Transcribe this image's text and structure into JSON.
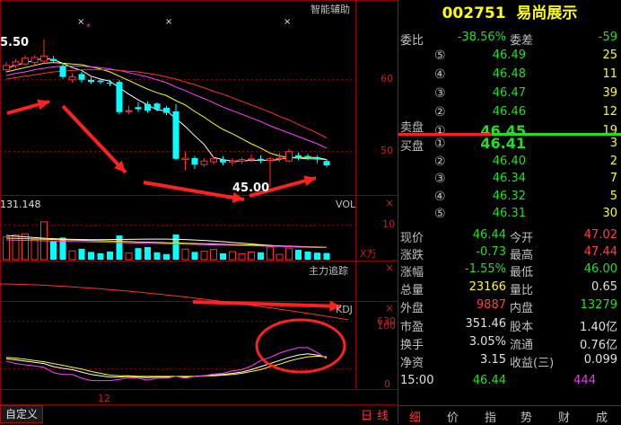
{
  "chart": {
    "title": "智能辅助",
    "price_high_label": "5.50",
    "price_low_label": "45.00",
    "price_axis": [
      "60",
      "50"
    ],
    "vol_panel": {
      "title": "VOL",
      "value": "131.148",
      "axis": "10",
      "unit": "X万"
    },
    "zlzj_panel": {
      "title": "主力追踪",
      "axis": "630"
    },
    "kdj_panel": {
      "title": "KDJ",
      "axis": [
        "100",
        "0"
      ]
    },
    "date_label": "12",
    "close_symbol": "×",
    "bottom_left": "自定义",
    "bottom_right": [
      "日",
      "线"
    ],
    "colors": {
      "up": "#ff3030",
      "down": "#00ffff",
      "ma5": "#ffffff",
      "ma10": "#ffff00",
      "ma20": "#ff40ff",
      "ma30": "#ff3030",
      "grid": "#8b0000"
    }
  },
  "quote": {
    "code": "002751",
    "name": "易尚展示",
    "weibi_label": "委比",
    "weibi_value": "-38.56%",
    "weicha_label": "委差",
    "weicha_value": "-59",
    "sell_label": "卖盘",
    "buy_label": "买盘",
    "sells": [
      {
        "n": "⑤",
        "price": "46.49",
        "vol": "25"
      },
      {
        "n": "④",
        "price": "46.48",
        "vol": "11"
      },
      {
        "n": "③",
        "price": "46.47",
        "vol": "39"
      },
      {
        "n": "②",
        "price": "46.46",
        "vol": "12"
      },
      {
        "n": "①",
        "price": "46.45",
        "vol": "19"
      }
    ],
    "buys": [
      {
        "n": "①",
        "price": "46.41",
        "vol": "3"
      },
      {
        "n": "②",
        "price": "46.40",
        "vol": "2"
      },
      {
        "n": "③",
        "price": "46.34",
        "vol": "7"
      },
      {
        "n": "④",
        "price": "46.32",
        "vol": "5"
      },
      {
        "n": "⑤",
        "price": "46.31",
        "vol": "30"
      }
    ],
    "stats": [
      {
        "l1": "现价",
        "v1": "46.44",
        "c1": "green",
        "l2": "今开",
        "v2": "47.02",
        "c2": "red"
      },
      {
        "l1": "涨跌",
        "v1": "-0.73",
        "c1": "green",
        "l2": "最高",
        "v2": "47.44",
        "c2": "red"
      },
      {
        "l1": "涨幅",
        "v1": "-1.55%",
        "c1": "green",
        "l2": "最低",
        "v2": "46.00",
        "c2": "green"
      },
      {
        "l1": "总量",
        "v1": "23166",
        "c1": "yellow",
        "l2": "量比",
        "v2": "0.65",
        "c2": "white"
      },
      {
        "l1": "外盘",
        "v1": "9887",
        "c1": "red",
        "l2": "内盘",
        "v2": "13279",
        "c2": "green"
      },
      {
        "l1": "市盈",
        "v1": "351.46",
        "c1": "white",
        "l2": "股本",
        "v2": "1.40亿",
        "c2": "white"
      },
      {
        "l1": "换手",
        "v1": "3.05%",
        "c1": "white",
        "l2": "流通",
        "v2": "0.76亿",
        "c2": "white"
      },
      {
        "l1": "净资",
        "v1": "3.15",
        "c1": "white",
        "l2": "收益(三)",
        "v2": "0.099",
        "c2": "white"
      }
    ],
    "tick": {
      "time": "15:00",
      "price": "46.44",
      "vol": "444"
    },
    "tabs": [
      "细",
      "价",
      "指",
      "势",
      "财",
      "成"
    ]
  },
  "chart_data": {
    "type": "candlestick",
    "title": "",
    "y_range": [
      43,
      68
    ],
    "high_marker": 65.5,
    "low_marker": 45.0,
    "candles": [
      {
        "o": 61.3,
        "c": 61.9,
        "h": 62.4,
        "l": 60.9,
        "dir": "up"
      },
      {
        "o": 61.9,
        "c": 62.4,
        "h": 62.8,
        "l": 61.5,
        "dir": "up"
      },
      {
        "o": 62.1,
        "c": 62.9,
        "h": 63.3,
        "l": 61.8,
        "dir": "up"
      },
      {
        "o": 62.3,
        "c": 63.0,
        "h": 63.3,
        "l": 61.9,
        "dir": "up"
      },
      {
        "o": 62.5,
        "c": 63.2,
        "h": 65.5,
        "l": 62.1,
        "dir": "up"
      },
      {
        "o": 62.8,
        "c": 62.5,
        "h": 63.2,
        "l": 62.2,
        "dir": "down"
      },
      {
        "o": 61.8,
        "c": 60.3,
        "h": 62.2,
        "l": 60.0,
        "dir": "down"
      },
      {
        "o": 60.3,
        "c": 59.9,
        "h": 60.8,
        "l": 59.5,
        "dir": "up"
      },
      {
        "o": 60.7,
        "c": 59.9,
        "h": 61.0,
        "l": 59.5,
        "dir": "down"
      },
      {
        "o": 59.9,
        "c": 59.6,
        "h": 60.3,
        "l": 59.3,
        "dir": "down"
      },
      {
        "o": 59.8,
        "c": 59.6,
        "h": 60.1,
        "l": 59.3,
        "dir": "down"
      },
      {
        "o": 59.5,
        "c": 59.4,
        "h": 59.9,
        "l": 59.0,
        "dir": "down"
      },
      {
        "o": 59.6,
        "c": 55.4,
        "h": 59.9,
        "l": 55.1,
        "dir": "down"
      },
      {
        "o": 55.5,
        "c": 55.6,
        "h": 56.3,
        "l": 55.1,
        "dir": "up"
      },
      {
        "o": 56.1,
        "c": 55.8,
        "h": 56.8,
        "l": 55.4,
        "dir": "down"
      },
      {
        "o": 56.5,
        "c": 55.6,
        "h": 56.9,
        "l": 55.3,
        "dir": "down"
      },
      {
        "o": 56.6,
        "c": 55.8,
        "h": 56.8,
        "l": 55.5,
        "dir": "down"
      },
      {
        "o": 56.0,
        "c": 55.3,
        "h": 56.3,
        "l": 55.0,
        "dir": "down"
      },
      {
        "o": 55.5,
        "c": 48.9,
        "h": 56.5,
        "l": 48.7,
        "dir": "down"
      },
      {
        "o": 48.8,
        "c": 49.0,
        "h": 49.9,
        "l": 47.3,
        "dir": "up"
      },
      {
        "o": 49.0,
        "c": 48.1,
        "h": 49.3,
        "l": 47.5,
        "dir": "down"
      },
      {
        "o": 48.1,
        "c": 48.6,
        "h": 49.0,
        "l": 47.8,
        "dir": "up"
      },
      {
        "o": 48.5,
        "c": 48.9,
        "h": 49.2,
        "l": 48.1,
        "dir": "up"
      },
      {
        "o": 48.8,
        "c": 48.4,
        "h": 49.3,
        "l": 48.0,
        "dir": "down"
      },
      {
        "o": 48.4,
        "c": 48.6,
        "h": 49.0,
        "l": 47.9,
        "dir": "up"
      },
      {
        "o": 48.6,
        "c": 48.8,
        "h": 49.1,
        "l": 48.2,
        "dir": "up"
      },
      {
        "o": 48.8,
        "c": 48.9,
        "h": 49.5,
        "l": 48.4,
        "dir": "up"
      },
      {
        "o": 48.9,
        "c": 48.7,
        "h": 49.4,
        "l": 48.3,
        "dir": "down"
      },
      {
        "o": 48.7,
        "c": 48.9,
        "h": 49.2,
        "l": 45.0,
        "dir": "up"
      },
      {
        "o": 48.9,
        "c": 49.0,
        "h": 49.7,
        "l": 48.5,
        "dir": "up"
      },
      {
        "o": 48.6,
        "c": 49.9,
        "h": 50.3,
        "l": 48.4,
        "dir": "up"
      },
      {
        "o": 49.4,
        "c": 49.0,
        "h": 49.8,
        "l": 48.7,
        "dir": "down"
      },
      {
        "o": 49.3,
        "c": 49.0,
        "h": 49.6,
        "l": 48.7,
        "dir": "down"
      },
      {
        "o": 49.0,
        "c": 48.8,
        "h": 49.4,
        "l": 48.3,
        "dir": "down"
      },
      {
        "o": 48.6,
        "c": 48.0,
        "h": 48.9,
        "l": 47.7,
        "dir": "down"
      }
    ],
    "ma_series": [
      {
        "name": "MA5",
        "color": "#ffffff",
        "values": [
          61.5,
          61.9,
          62.3,
          62.6,
          62.9,
          62.7,
          62.2,
          61.6,
          61.2,
          60.4,
          60.0,
          59.7,
          58.8,
          57.9,
          57.1,
          56.4,
          55.7,
          55.6,
          54.5,
          53.4,
          52.1,
          50.9,
          49.1,
          48.8,
          48.6,
          48.6,
          48.7,
          48.7,
          48.7,
          48.8,
          49.1,
          49.1,
          49.1,
          49.1,
          48.8
        ]
      },
      {
        "name": "MA10",
        "color": "#ffff00",
        "values": [
          61.0,
          61.3,
          61.6,
          61.9,
          62.2,
          62.3,
          62.2,
          62.1,
          62.0,
          61.7,
          61.4,
          61.0,
          60.4,
          59.8,
          59.2,
          58.6,
          58.1,
          57.7,
          57.0,
          56.4,
          55.5,
          54.7,
          53.8,
          53.0,
          52.4,
          51.7,
          51.0,
          50.4,
          49.7,
          49.3,
          49.1,
          49.0,
          48.9,
          48.9,
          48.8
        ]
      },
      {
        "name": "MA20",
        "color": "#ff40ff",
        "values": [
          60.5,
          60.8,
          61.0,
          61.3,
          61.5,
          61.7,
          61.8,
          61.8,
          61.8,
          61.7,
          61.6,
          61.4,
          61.2,
          60.9,
          60.6,
          60.3,
          59.9,
          59.5,
          58.9,
          58.4,
          57.8,
          57.3,
          56.7,
          56.1,
          55.6,
          55.1,
          54.6,
          54.1,
          53.5,
          53.0,
          52.5,
          52.0,
          51.5,
          51.0,
          50.4
        ]
      },
      {
        "name": "MA30",
        "color": "#ff3030",
        "values": [
          60.0,
          60.2,
          60.4,
          60.6,
          60.8,
          61.0,
          61.1,
          61.2,
          61.3,
          61.3,
          61.3,
          61.3,
          61.2,
          61.1,
          61.0,
          60.8,
          60.6,
          60.3,
          60.0,
          59.6,
          59.2,
          58.8,
          58.3,
          57.9,
          57.4,
          56.9,
          56.4,
          55.9,
          55.4,
          54.8,
          54.3,
          53.7,
          53.1,
          52.5,
          51.8
        ]
      }
    ],
    "volume": [
      6.5,
      7.1,
      7.4,
      5.8,
      10.8,
      5.2,
      6.3,
      2.5,
      3.1,
      2.2,
      1.8,
      2.3,
      6.9,
      1.9,
      3.3,
      3.6,
      2.1,
      1.6,
      7.2,
      3.0,
      2.2,
      2.4,
      2.9,
      1.8,
      2.3,
      1.7,
      2.2,
      2.1,
      3.6,
      1.5,
      3.3,
      2.8,
      2.3,
      2.0,
      1.9
    ],
    "kdj": {
      "K": [
        38,
        36,
        34,
        32,
        30,
        25,
        22,
        20,
        16,
        12,
        10,
        8,
        8,
        9,
        8,
        7,
        8,
        8,
        9,
        8,
        9,
        10,
        11,
        12,
        14,
        16,
        20,
        25,
        30,
        35,
        40,
        44,
        46,
        44,
        40
      ],
      "D": [
        40,
        39,
        37,
        35,
        33,
        30,
        27,
        24,
        21,
        17,
        14,
        11,
        10,
        10,
        9,
        9,
        9,
        9,
        9,
        9,
        9,
        10,
        10,
        11,
        12,
        14,
        17,
        20,
        25,
        29,
        34,
        38,
        41,
        42,
        41
      ],
      "J": [
        34,
        30,
        28,
        26,
        24,
        15,
        12,
        12,
        6,
        2,
        2,
        2,
        4,
        7,
        6,
        3,
        6,
        6,
        9,
        6,
        9,
        10,
        13,
        14,
        18,
        20,
        26,
        35,
        40,
        47,
        52,
        56,
        56,
        48,
        38
      ]
    }
  }
}
